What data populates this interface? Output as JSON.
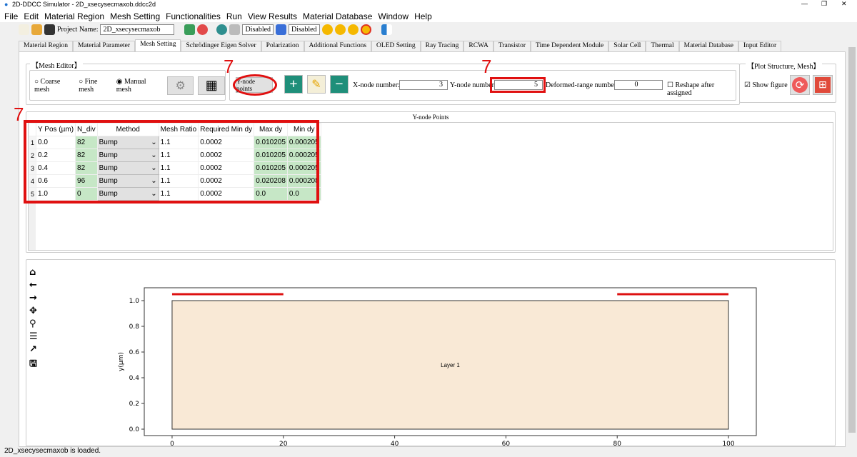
{
  "window": {
    "title": "2D-DDCC Simulator - 2D_xsecysecmaxob.ddcc2d",
    "controls": [
      "—",
      "❐",
      "✕"
    ]
  },
  "menu": [
    "File",
    "Edit",
    "Material Region",
    "Mesh Setting",
    "Functionalities",
    "Run",
    "View Results",
    "Material Database",
    "Window",
    "Help"
  ],
  "toolbar": {
    "project_label": "Project Name:",
    "project_value": "2D_xsecysecmaxob",
    "disabled1": "Disabled",
    "disabled2": "Disabled"
  },
  "tabs": [
    "Material Region",
    "Material Parameter",
    "Mesh Setting",
    "Schrödinger Eigen Solver",
    "Polarization",
    "Additional Functions",
    "OLED Setting",
    "Ray Tracing",
    "RCWA",
    "Transistor",
    "Time Dependent Module",
    "Solar Cell",
    "Thermal",
    "Material Database",
    "Input Editor"
  ],
  "active_tab": "Mesh Setting",
  "mesh_editor": {
    "title": "【Mesh Editor】",
    "radios": [
      {
        "label": "Coarse mesh",
        "checked": false
      },
      {
        "label": "Fine mesh",
        "checked": false
      },
      {
        "label": "Manual mesh",
        "checked": true
      }
    ],
    "node_select": "Y-node points",
    "x_node_label": "X-node number:",
    "x_node_value": "3",
    "y_node_label": "Y-node number:",
    "y_node_value": "5",
    "deformed_label": "Deformed-range number:",
    "deformed_value": "0",
    "reshape_label": "Reshape after assigned",
    "reshape_checked": false
  },
  "plot_structure": {
    "title": "【Plot Structure, Mesh】",
    "show_figure": "Show figure",
    "checked": true
  },
  "annotations": {
    "a1": "7",
    "a2": "7",
    "a3": "7",
    "color": "#e01010"
  },
  "ynode_panel": {
    "title": "Y-node Points",
    "columns": [
      "",
      "Y Pos (µm)",
      "N_div",
      "Method",
      "Mesh Ratio",
      "Required Min dy",
      "Max dy",
      "Min dy"
    ],
    "rows": [
      [
        "1",
        "0.0",
        "82",
        "Bump",
        "1.1",
        "0.0002",
        "0.010205",
        "0.000205"
      ],
      [
        "2",
        "0.2",
        "82",
        "Bump",
        "1.1",
        "0.0002",
        "0.010205",
        "0.000205"
      ],
      [
        "3",
        "0.4",
        "82",
        "Bump",
        "1.1",
        "0.0002",
        "0.010205",
        "0.000205"
      ],
      [
        "4",
        "0.6",
        "96",
        "Bump",
        "1.1",
        "0.0002",
        "0.020208",
        "0.000208"
      ],
      [
        "5",
        "1.0",
        "0",
        "Bump",
        "1.1",
        "0.0002",
        "0.0",
        "0.0"
      ]
    ]
  },
  "plot_toolbar": [
    "home-icon",
    "back-icon",
    "forward-icon",
    "pan-icon",
    "zoom-icon",
    "configure-icon",
    "edit-axis-icon",
    "save-icon"
  ],
  "chart_data": {
    "type": "area",
    "ylabel": "y(µm)",
    "xlabel": "",
    "xlim": [
      -5,
      105
    ],
    "ylim": [
      -0.05,
      1.1
    ],
    "xticks": [
      0,
      20,
      40,
      60,
      80,
      100
    ],
    "yticks": [
      0.0,
      0.2,
      0.4,
      0.6,
      0.8,
      1.0
    ],
    "regions": [
      {
        "label": "Layer 1",
        "x": [
          0,
          100
        ],
        "y": [
          0,
          1.0
        ],
        "color": "#f9e9d6"
      }
    ],
    "lines": [
      {
        "x": [
          0,
          20
        ],
        "y": 1.05,
        "color": "#dd1111"
      },
      {
        "x": [
          80,
          100
        ],
        "y": 1.05,
        "color": "#dd1111"
      }
    ]
  },
  "status": "2D_xsecysecmaxob is loaded."
}
